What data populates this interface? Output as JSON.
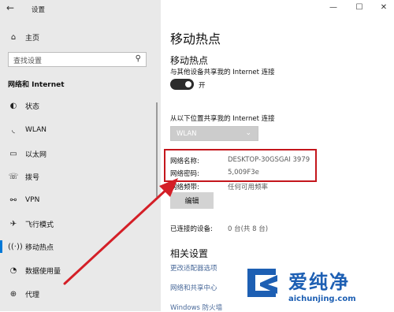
{
  "window": {
    "title": "设置",
    "back_glyph": "←",
    "minimize": "—",
    "maximize": "☐",
    "close": "✕"
  },
  "sidebar": {
    "home_label": "主页",
    "search_placeholder": "查找设置",
    "section_title": "网络和 Internet",
    "items": [
      {
        "label": "状态",
        "icon": "status-icon"
      },
      {
        "label": "WLAN",
        "icon": "wifi-icon"
      },
      {
        "label": "以太网",
        "icon": "ethernet-icon"
      },
      {
        "label": "拨号",
        "icon": "dialup-icon"
      },
      {
        "label": "VPN",
        "icon": "vpn-icon"
      },
      {
        "label": "飞行模式",
        "icon": "airplane-icon"
      },
      {
        "label": "移动热点",
        "icon": "hotspot-icon"
      },
      {
        "label": "数据使用量",
        "icon": "data-usage-icon"
      },
      {
        "label": "代理",
        "icon": "globe-icon"
      }
    ],
    "active_item": "移动热点"
  },
  "main": {
    "page_title": "移动热点",
    "subtitle": "移动热点",
    "share_desc": "与其他设备共享我的 Internet 连接",
    "toggle_state": "开",
    "share_from_label": "从以下位置共享我的 Internet 连接",
    "share_from_value": "WLAN",
    "network_name_label": "网络名称:",
    "network_name_value": "DESKTOP-30GSGAI 3979",
    "network_password_label": "网络密码:",
    "network_password_value": "5,009F3e",
    "network_band_label": "网络频带:",
    "network_band_value": "任何可用频率",
    "edit_button": "编辑",
    "connected_label": "已连接的设备:",
    "connected_value": "0 台(共 8 台)",
    "related_title": "相关设置",
    "related_links": [
      "更改适配器选项",
      "网络和共享中心",
      "Windows 防火墙"
    ]
  },
  "watermark": {
    "brand_cn": "爱纯净",
    "url": "aichunjing.com"
  },
  "colors": {
    "accent": "#0078d7",
    "highlight_box": "#c4161c",
    "arrow": "#d41f27",
    "logo_blue": "#1d5fb3"
  }
}
